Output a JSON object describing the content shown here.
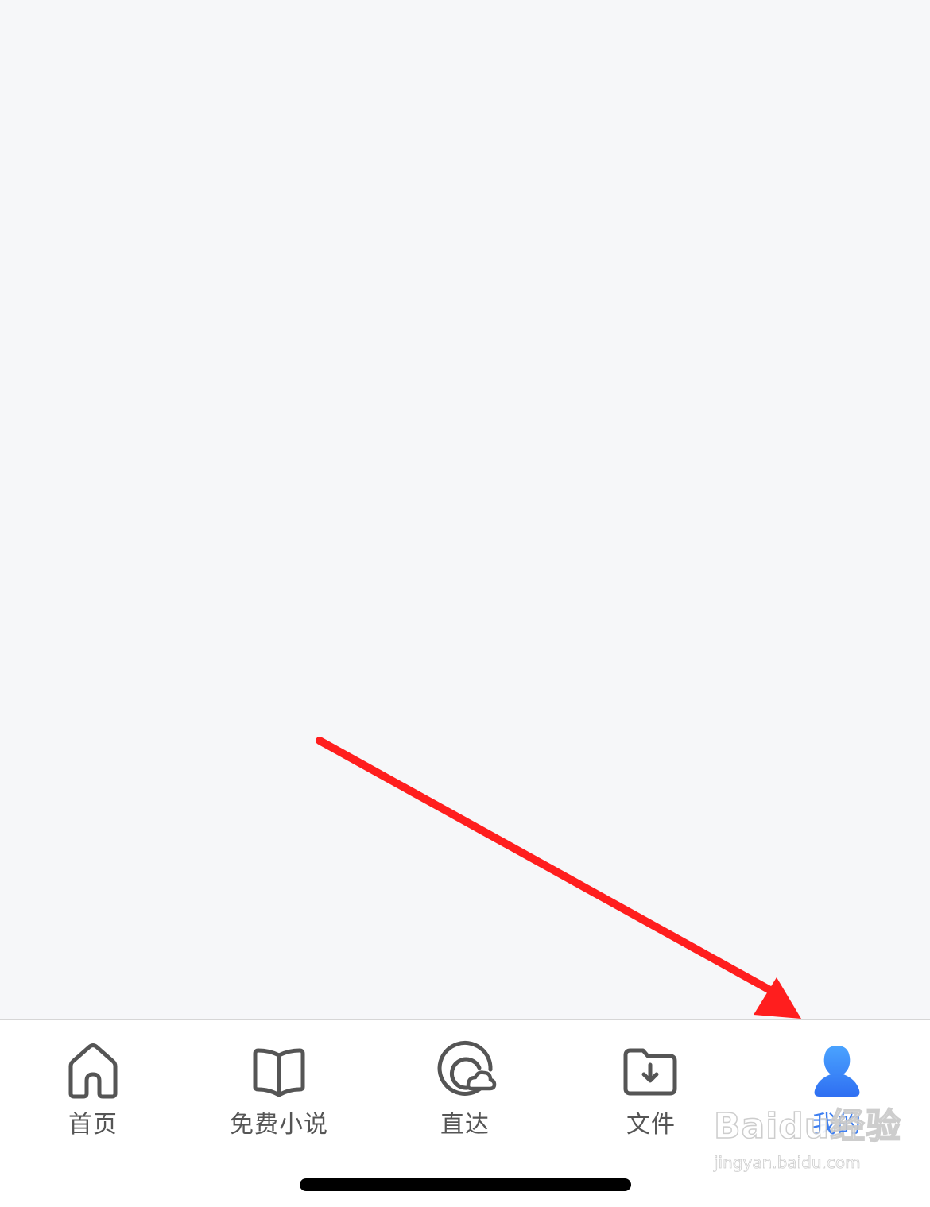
{
  "tab_bar": {
    "items": [
      {
        "label": "首页",
        "icon": "home-icon",
        "active": false
      },
      {
        "label": "免费小说",
        "icon": "open-book-icon",
        "active": false
      },
      {
        "label": "直达",
        "icon": "direct-access-icon",
        "active": false
      },
      {
        "label": "文件",
        "icon": "folder-download-icon",
        "active": false
      },
      {
        "label": "我的",
        "icon": "user-profile-icon",
        "active": true
      }
    ]
  },
  "colors": {
    "background": "#f6f7f9",
    "tab_bar_background": "#ffffff",
    "tab_label": "#555555",
    "active_tab": "#3d7ef0",
    "annotation_arrow": "#ff1e1e"
  },
  "watermark": {
    "logo": "Baidu经验",
    "url": "jingyan.baidu.com"
  }
}
